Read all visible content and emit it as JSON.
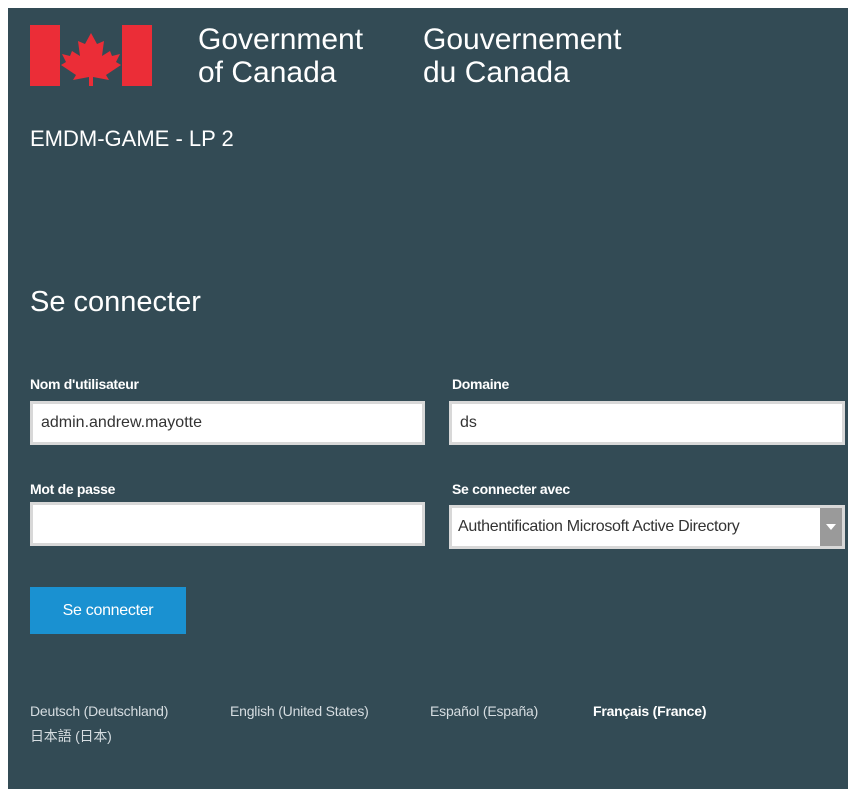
{
  "header": {
    "gov_en_line1": "Government",
    "gov_en_line2": "of Canada",
    "gov_fr_line1": "Gouvernement",
    "gov_fr_line2": "du Canada",
    "flag_icon": "canada-flag-icon",
    "app_title": "EMDM-GAME - LP 2"
  },
  "login": {
    "heading": "Se connecter",
    "username_label": "Nom d'utilisateur",
    "username_value": "admin.andrew.mayotte",
    "domain_label": "Domaine",
    "domain_value": "ds",
    "password_label": "Mot de passe",
    "password_value": "",
    "auth_label": "Se connecter avec",
    "auth_selected": "Authentification Microsoft Active Directory",
    "submit_label": "Se connecter"
  },
  "languages": [
    {
      "label": "Deutsch (Deutschland)",
      "active": false
    },
    {
      "label": "English (United States)",
      "active": false
    },
    {
      "label": "Español (España)",
      "active": false
    },
    {
      "label": "Français (France)",
      "active": true
    },
    {
      "label": "日本語 (日本)",
      "active": false
    }
  ],
  "colors": {
    "background": "#334b55",
    "button": "#1a91d1",
    "flag_red": "#eb2d37"
  }
}
